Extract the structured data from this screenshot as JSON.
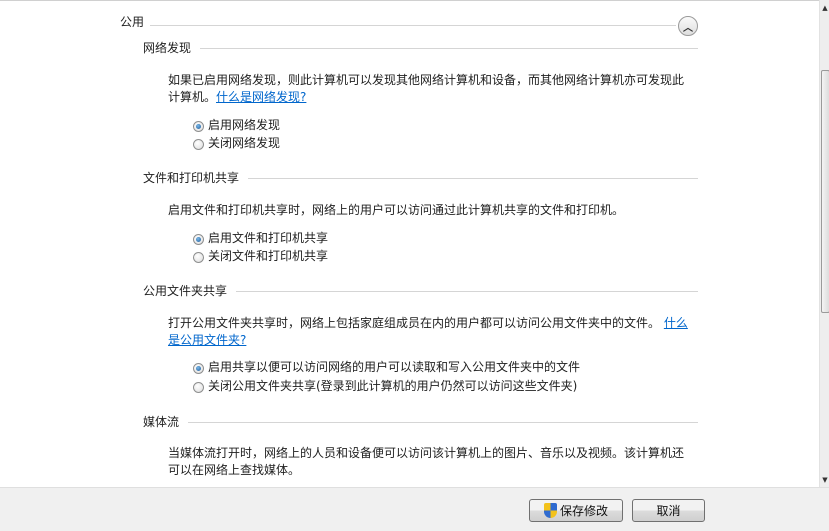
{
  "group_title": "公用",
  "sections": [
    {
      "title": "网络发现",
      "desc_line1": "如果已启用网络发现，则此计算机可以发现其他网络计算机和设备，而其他网络计算机亦可发现此",
      "desc_line2": "计算机。",
      "link": "什么是网络发现?",
      "options": [
        {
          "label": "启用网络发现",
          "checked": true
        },
        {
          "label": "关闭网络发现",
          "checked": false
        }
      ]
    },
    {
      "title": "文件和打印机共享",
      "desc_line1": "启用文件和打印机共享时，网络上的用户可以访问通过此计算机共享的文件和打印机。",
      "options": [
        {
          "label": "启用文件和打印机共享",
          "checked": true
        },
        {
          "label": "关闭文件和打印机共享",
          "checked": false
        }
      ]
    },
    {
      "title": "公用文件夹共享",
      "desc_line1": "打开公用文件夹共享时，网络上包括家庭组成员在内的用户都可以访问公用文件夹中的文件。",
      "link_part1": "什么",
      "link_part2": "是公用文件夹?",
      "options": [
        {
          "label": "启用共享以便可以访问网络的用户可以读取和写入公用文件夹中的文件",
          "checked": true
        },
        {
          "label": "关闭公用文件夹共享(登录到此计算机的用户仍然可以访问这些文件夹)",
          "checked": false
        }
      ]
    },
    {
      "title": "媒体流",
      "desc_line1": "当媒体流打开时，网络上的人员和设备便可以访问该计算机上的图片、音乐以及视频。该计算机还",
      "desc_line2": "可以在网络上查找媒体。"
    }
  ],
  "footer": {
    "save_label": "保存修改",
    "cancel_label": "取消"
  }
}
